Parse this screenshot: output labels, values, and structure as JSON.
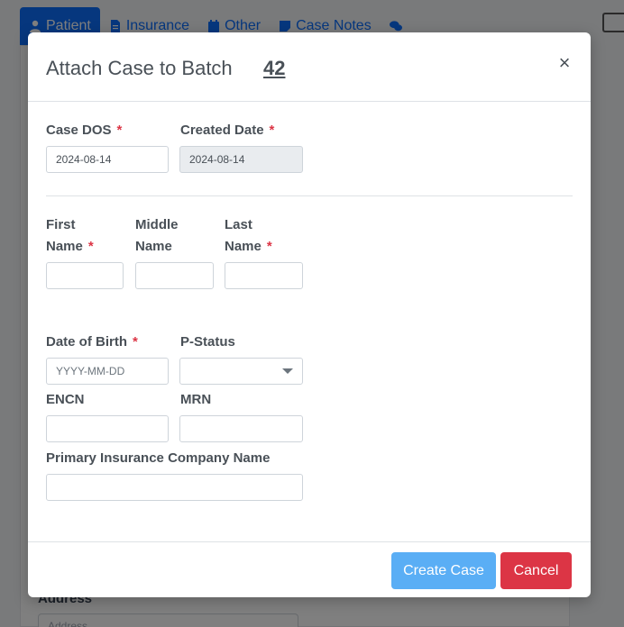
{
  "background": {
    "tabs": [
      {
        "label": "Patient",
        "icon": "user-icon",
        "active": true
      },
      {
        "label": "Insurance",
        "icon": "file-icon",
        "active": false
      },
      {
        "label": "Other",
        "icon": "calendar-icon",
        "active": false
      },
      {
        "label": "Case Notes",
        "icon": "note-icon",
        "active": false
      },
      {
        "label": "",
        "icon": "comments-icon",
        "active": false
      }
    ],
    "address_label": "Address",
    "address_placeholder": "Address"
  },
  "modal": {
    "title": "Attach Case to Batch",
    "batch_number": "42",
    "close_symbol": "×"
  },
  "form": {
    "case_dos": {
      "label": "Case DOS",
      "required": "*",
      "value": "2024-08-14"
    },
    "created_date": {
      "label": "Created Date",
      "required": "*",
      "value": "2024-08-14"
    },
    "first_name": {
      "label_line1": "First",
      "label_line2": "Name",
      "required": "*",
      "value": ""
    },
    "middle_name": {
      "label_line1": "Middle",
      "label_line2": "Name",
      "value": ""
    },
    "last_name": {
      "label_line1": "Last",
      "label_line2": "Name",
      "required": "*",
      "value": ""
    },
    "date_of_birth": {
      "label": "Date of Birth",
      "required": "*",
      "placeholder": "YYYY-MM-DD"
    },
    "p_status": {
      "label": "P-Status",
      "value": ""
    },
    "encn": {
      "label": "ENCN",
      "value": ""
    },
    "mrn": {
      "label": "MRN",
      "value": ""
    },
    "primary_insurance": {
      "label": "Primary Insurance Company Name",
      "value": ""
    }
  },
  "footer": {
    "create_label": "Create Case",
    "cancel_label": "Cancel"
  },
  "colors": {
    "primary": "#0d6efd",
    "create_button": "#5aaef5",
    "cancel_button": "#dc3545",
    "required": "#dc3545"
  }
}
